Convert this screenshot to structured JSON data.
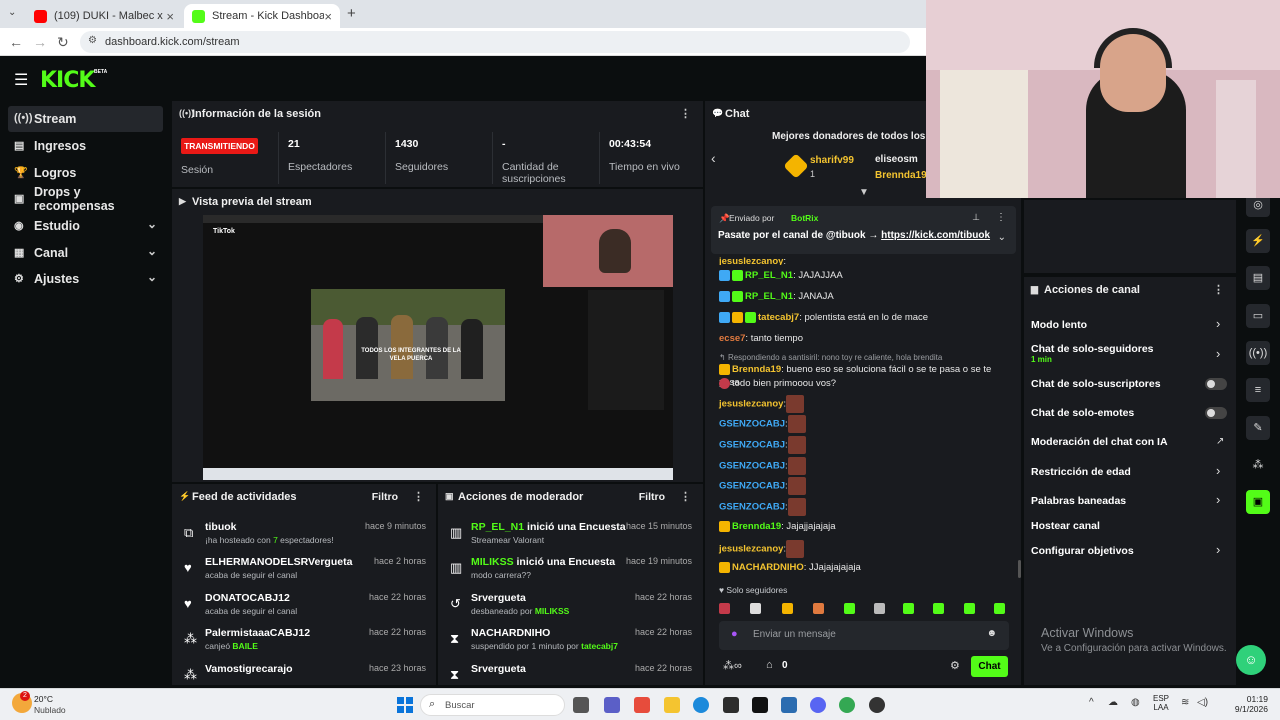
{
  "browser": {
    "tabs": [
      {
        "label": "(109) DUKI - Malbec x Bizarrap"
      },
      {
        "label": "Stream - Kick Dashboard"
      }
    ],
    "url": "dashboard.kick.com/stream"
  },
  "logo": {
    "text": "KICK",
    "beta": "BETA"
  },
  "sidebar": {
    "items": [
      {
        "label": "Stream"
      },
      {
        "label": "Ingresos"
      },
      {
        "label": "Logros"
      },
      {
        "label": "Drops y recompensas"
      },
      {
        "label": "Estudio"
      },
      {
        "label": "Canal"
      },
      {
        "label": "Ajustes"
      }
    ]
  },
  "session": {
    "title": "Información de la sesión",
    "status": "TRANSMITIENDO",
    "status_label": "Sesión",
    "stats": [
      {
        "value": "21",
        "label": "Espectadores"
      },
      {
        "value": "1430",
        "label": "Seguidores"
      },
      {
        "value": "-",
        "label": "Cantidad de suscripciones"
      },
      {
        "value": "00:43:54",
        "label": "Tiempo en vivo"
      }
    ]
  },
  "preview": {
    "title": "Vista previa del stream",
    "video_caption": "TODOS LOS INTEGRANTES DE LA VELA PUERCA",
    "tiktok_label": "TikTok"
  },
  "feed": {
    "title": "Feed de actividades",
    "filter": "Filtro",
    "rows": [
      {
        "name": "tibuok",
        "time": "hace 9 minutos",
        "sub_a": "¡ha hosteado con ",
        "sub_b": "7",
        "sub_c": " espectadores!"
      },
      {
        "name": "ELHERMANODELSRVergueta",
        "time": "hace 2 horas",
        "sub_a": "acaba de seguir el canal",
        "sub_b": "",
        "sub_c": ""
      },
      {
        "name": "DONATOCABJ12",
        "time": "hace 22 horas",
        "sub_a": "acaba de seguir el canal",
        "sub_b": "",
        "sub_c": ""
      },
      {
        "name": "PalermistaaaCABJ12",
        "time": "hace 22 horas",
        "sub_a": "canjeó ",
        "sub_b": "BAILE",
        "sub_c": ""
      },
      {
        "name": "Vamostigrecarajo",
        "time": "hace 23 horas",
        "sub_a": "",
        "sub_b": "",
        "sub_c": ""
      }
    ]
  },
  "mod": {
    "title": "Acciones de moderador",
    "filter": "Filtro",
    "rows": [
      {
        "name": "RP_EL_N1",
        "action": " inició una Encuesta",
        "time": "hace 15 minutos",
        "sub_a": "Streamear Valorant",
        "sub_b": ""
      },
      {
        "name": "MILIKSS",
        "action": " inició una Encuesta",
        "time": "hace 19 minutos",
        "sub_a": "modo carrera??",
        "sub_b": ""
      },
      {
        "name": "Srvergueta",
        "action": "",
        "time": "hace 22 horas",
        "sub_a": "desbaneado por ",
        "sub_b": "MILIKSS"
      },
      {
        "name": "NACHARDNIHO",
        "action": "",
        "time": "hace 22 horas",
        "sub_a": "suspendido por 1 minuto por ",
        "sub_b": "tatecabj7"
      },
      {
        "name": "Srvergueta",
        "action": "",
        "time": "hace 22 horas",
        "sub_a": "",
        "sub_b": ""
      }
    ]
  },
  "chat": {
    "title": "Chat",
    "donors_title": "Mejores donadores de todos los ti",
    "donor1": "sharifv99",
    "donor1_count": "1",
    "donor2": "eliseosm",
    "donor3": "Brennda19",
    "pinned_by_label": "Enviado por",
    "pinned_by": "BotRix",
    "pinned_text": "Pasate por el canal de @tibuok → ",
    "pinned_link": "https://kick.com/tibuok",
    "messages": [
      {
        "user": "jesuslezcanoy",
        "text": ":",
        "color": "#f4c430"
      },
      {
        "user": "RP_EL_N1",
        "text": ": JAJAJJAA",
        "color": "#53fc18"
      },
      {
        "user": "RP_EL_N1",
        "text": ": JANAJA",
        "color": "#53fc18"
      },
      {
        "user": "tatecabj7",
        "text": ": polentista está en lo de mace",
        "color": "#f4c430"
      },
      {
        "user": "ecse7",
        "text": ": tanto tiempo",
        "color": "#e07a3f"
      },
      {
        "user": "Brennda19",
        "text": ": bueno eso se soluciona fácil o se te pasa o se te pasa",
        "color": "#f4c430"
      },
      {
        "user": "jesuslezcanoy",
        "text": ":",
        "color": "#f4c430"
      },
      {
        "user": "GSENZOCABJ",
        "text": ":",
        "color": "#3fa9f5"
      },
      {
        "user": "GSENZOCABJ",
        "text": ":",
        "color": "#3fa9f5"
      },
      {
        "user": "GSENZOCABJ",
        "text": ":",
        "color": "#3fa9f5"
      },
      {
        "user": "GSENZOCABJ",
        "text": ":",
        "color": "#3fa9f5"
      },
      {
        "user": "GSENZOCABJ",
        "text": ":",
        "color": "#3fa9f5"
      },
      {
        "user": "Brennda19",
        "text": ": Jajajjajajaja",
        "color": "#53fc18"
      },
      {
        "user": "jesuslezcanoy",
        "text": ":",
        "color": "#f4c430"
      },
      {
        "user": "NACHARDNIHO",
        "text": ": JJajajajajaja",
        "color": "#f4c430"
      }
    ],
    "reply_note": "Respondiendo a santisiril: nono toy re caliente, hola brendita",
    "brennda_cont": "todo bien primooou vos?",
    "followers_only": "Solo seguidores",
    "input_placeholder": "Enviar un mensaje",
    "points": "0",
    "send_label": "Chat"
  },
  "actions": {
    "title": "Acciones de canal",
    "items": [
      {
        "label": "Modo lento",
        "sub": ""
      },
      {
        "label": "Chat de solo-seguidores",
        "sub": "1 min"
      },
      {
        "label": "Chat de solo-suscriptores",
        "sub": ""
      },
      {
        "label": "Chat de solo-emotes",
        "sub": ""
      },
      {
        "label": "Moderación del chat con IA",
        "sub": ""
      },
      {
        "label": "Restricción de edad",
        "sub": ""
      },
      {
        "label": "Palabras baneadas",
        "sub": ""
      },
      {
        "label": "Hostear canal",
        "sub": ""
      },
      {
        "label": "Configurar objetivos",
        "sub": ""
      }
    ]
  },
  "windows": {
    "activate_title": "Activar Windows",
    "activate_sub": "Ve a Configuración para activar Windows."
  },
  "taskbar": {
    "weather_temp": "20°C",
    "weather_text": "Nublado",
    "badge": "2",
    "search": "Buscar",
    "lang1": "ESP",
    "lang2": "LAA",
    "time": "01:19",
    "date": "9/1/2026"
  },
  "colors": {
    "accent": "#53fc18",
    "live": "#e91916",
    "panel": "#191b1f",
    "bg": "#0b0e0f"
  }
}
